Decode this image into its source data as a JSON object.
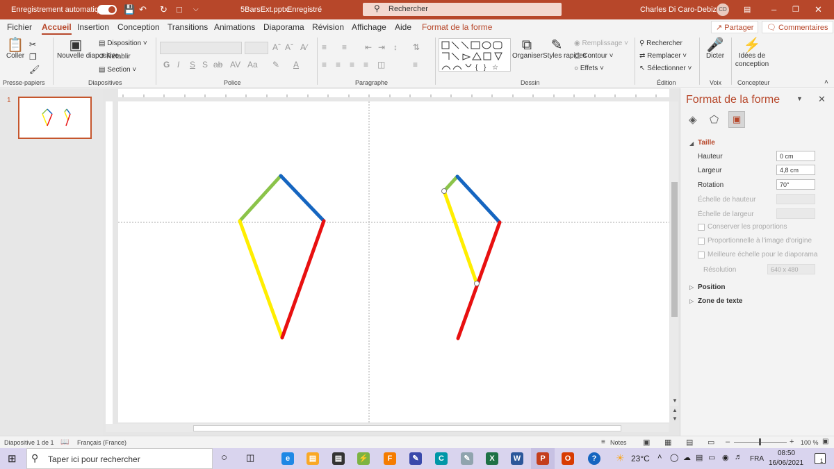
{
  "titlebar": {
    "autosave_label": "Enregistrement automatique",
    "doc_title": "5BarsExt.pptx",
    "save_status": "Enregistré",
    "search_placeholder": "Rechercher",
    "user_name": "Charles Di Caro-Debizet",
    "user_initials": "CD",
    "bg_color": "#b7472a"
  },
  "tabs": {
    "items": [
      "Fichier",
      "Accueil",
      "Insertion",
      "Conception",
      "Transitions",
      "Animations",
      "Diaporama",
      "Révision",
      "Affichage",
      "Aide",
      "Format de la forme"
    ],
    "share_label": "Partager",
    "comments_label": "Commentaires"
  },
  "ribbon": {
    "clipboard": {
      "paste": "Coller",
      "group": "Presse-papiers"
    },
    "slides": {
      "new_slide": "Nouvelle diapositive",
      "layout": "Disposition",
      "reset": "Rétablir",
      "section": "Section",
      "group": "Diapositives"
    },
    "font": {
      "group": "Police"
    },
    "paragraph": {
      "group": "Paragraphe"
    },
    "drawing": {
      "arrange": "Organiser",
      "quick_styles": "Styles rapides",
      "fill": "Remplissage",
      "outline": "Contour",
      "effects": "Effets",
      "group": "Dessin"
    },
    "editing": {
      "find": "Rechercher",
      "replace": "Remplacer",
      "select": "Sélectionner",
      "group": "Édition"
    },
    "voice": {
      "dictate": "Dicter",
      "group": "Voix"
    },
    "designer": {
      "ideas": "Idées de conception",
      "group": "Concepteur"
    }
  },
  "thumbnails": {
    "slide_number": "1"
  },
  "format_pane": {
    "title": "Format de la forme",
    "size_section": "Taille",
    "height_label": "Hauteur",
    "height_value": "0 cm",
    "width_label": "Largeur",
    "width_value": "4,8 cm",
    "rotation_label": "Rotation",
    "rotation_value": "70°",
    "scale_height_label": "Échelle de hauteur",
    "scale_width_label": "Échelle de largeur",
    "lock_ratio_label": "Conserver les proportions",
    "relative_label": "Proportionnelle à l'image d'origine",
    "best_scale_label": "Meilleure échelle pour le diaporama",
    "resolution_label": "Résolution",
    "resolution_value": "640 x 480",
    "position_section": "Position",
    "textbox_section": "Zone de texte"
  },
  "statusbar": {
    "slide_info": "Diapositive 1 de 1",
    "language": "Français (France)",
    "notes": "Notes",
    "zoom": "100 %"
  },
  "taskbar": {
    "search_placeholder": "Taper ici pour rechercher",
    "weather": "23°C",
    "lang": "FRA",
    "time": "08:50",
    "date": "16/06/2021",
    "notif_count": "1"
  },
  "colors": {
    "accent": "#b7472a",
    "bar_green": "#8bc34a",
    "bar_blue": "#1565c0",
    "bar_yellow": "#ffee00",
    "bar_red": "#e81010"
  }
}
